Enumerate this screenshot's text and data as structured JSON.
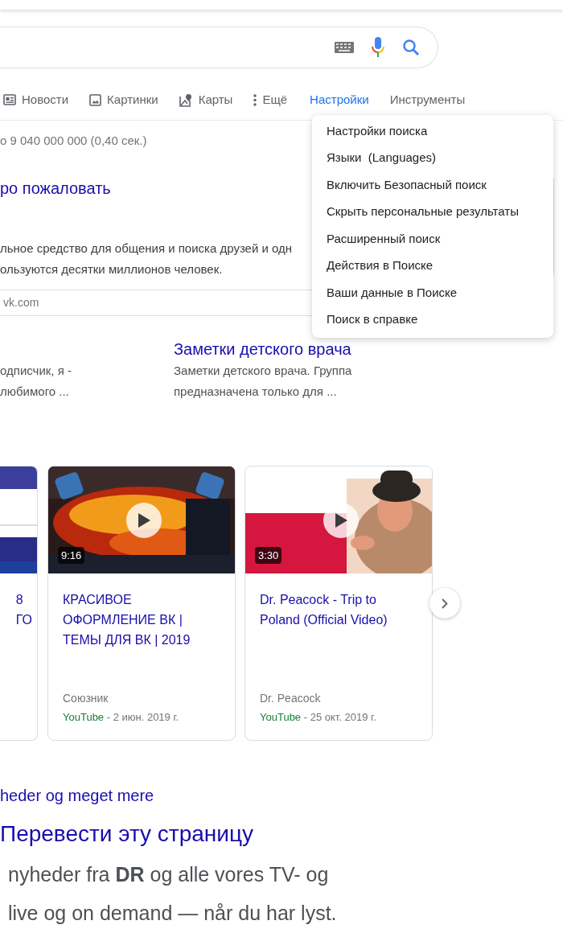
{
  "tabs": [
    {
      "label": "Новости",
      "kind": "news",
      "selected": false
    },
    {
      "label": "Картинки",
      "kind": "images",
      "selected": false
    },
    {
      "label": "Карты",
      "kind": "maps",
      "selected": false
    },
    {
      "label": "Ещё",
      "kind": "more",
      "selected": false
    },
    {
      "label": "Настройки",
      "kind": "text",
      "selected": true
    },
    {
      "label": "Инструменты",
      "kind": "text",
      "selected": false
    }
  ],
  "result_stats": "о 9 040 000 000 (0,40 сек.)",
  "result": {
    "title": "ро пожаловать",
    "snippet": [
      "льное средство для общения и поиска друзей и одн",
      "ользуются десятки миллионов человек."
    ],
    "url": "vk.com"
  },
  "sub_results": [
    {
      "snippet": [
        "одписчик, я -",
        "любимого ..."
      ]
    },
    {
      "title": "Заметки детского врача",
      "snippet": [
        "Заметки детского врача. Группа",
        "предназначена только для ..."
      ]
    }
  ],
  "videos": [
    {
      "title_lines": [
        "8",
        "ГО"
      ]
    },
    {
      "title_lines": [
        "КРАСИВОЕ",
        "ОФОРМЛЕНИЕ ВК |",
        "ТЕМЫ ДЛЯ ВК | 2019"
      ],
      "duration": "9:16",
      "channel": "Союзник",
      "source": "YouTube",
      "date": " - 2 июн. 2019 г."
    },
    {
      "title_lines": [
        "Dr. Peacock - Trip to",
        "Poland (Official Video)"
      ],
      "duration": "3:30",
      "channel": "Dr. Peacock",
      "source": "YouTube",
      "date": " - 25 окт. 2019 г."
    }
  ],
  "menu": {
    "items": [
      "Настройки поиска",
      "Языки  (Languages)",
      "Включить Безопасный поиск",
      "Скрыть персональные результаты",
      "Расширенный поиск",
      "Действия в Поиске",
      "Ваши данные в Поиске",
      "Поиск в справке"
    ]
  },
  "bottom_result": {
    "link": "heder og meget mere",
    "title": "Перевести эту страницу",
    "snippet": [
      "nyheder fra **DR** og alle vores TV- og",
      "live og on demand — når du har lyst."
    ]
  }
}
